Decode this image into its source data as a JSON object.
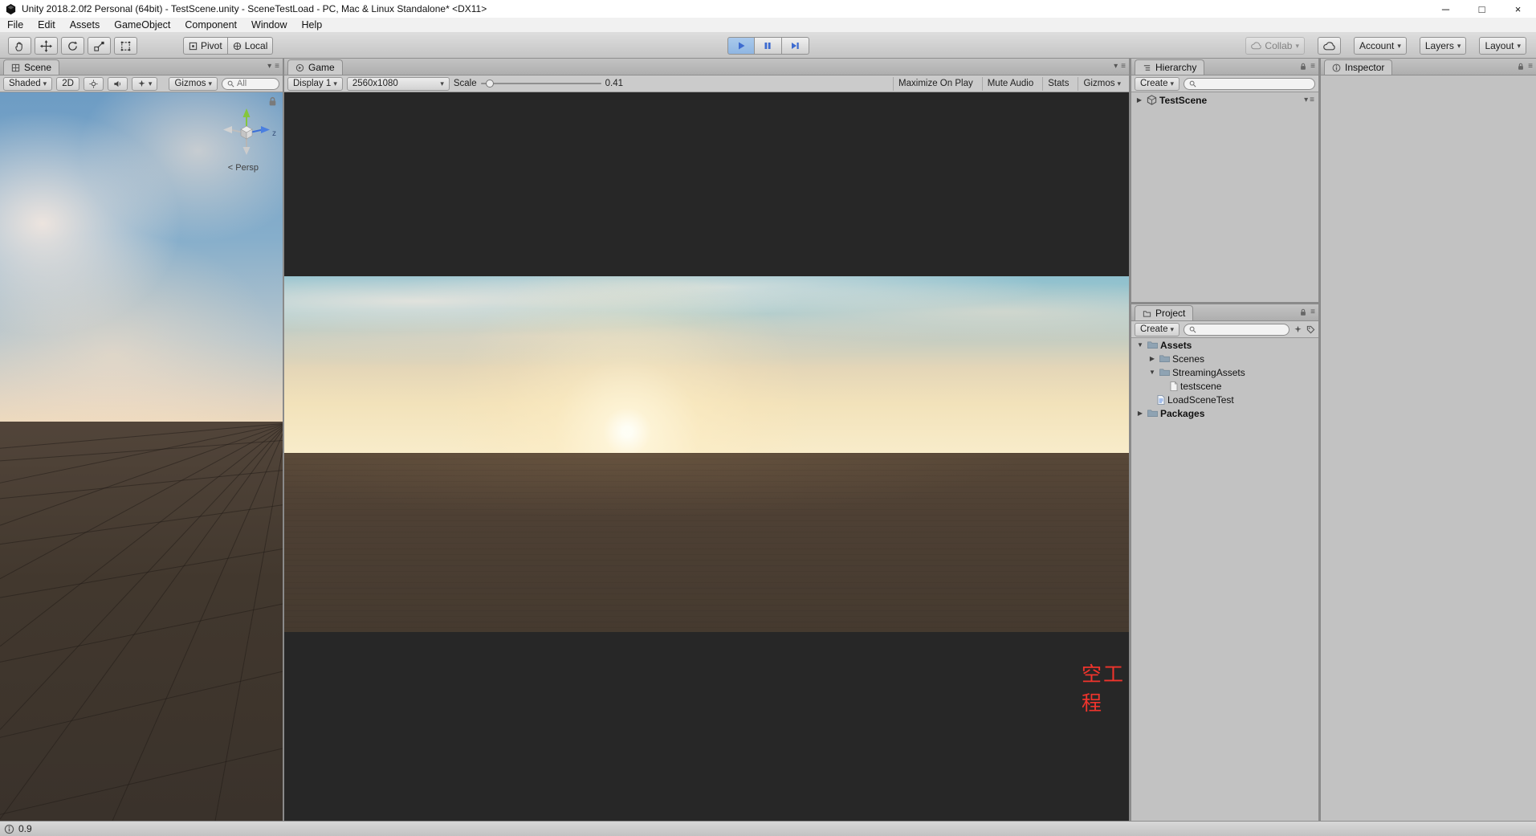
{
  "window": {
    "title": "Unity 2018.2.0f2 Personal (64bit) - TestScene.unity - SceneTestLoad - PC, Mac & Linux Standalone* <DX11>"
  },
  "icons": {
    "caret": "▾",
    "menu": "≡",
    "minimize": "─",
    "maximize": "□",
    "close": "×",
    "foldout_open": "▼",
    "foldout_closed": "▶"
  },
  "menu": {
    "items": [
      "File",
      "Edit",
      "Assets",
      "GameObject",
      "Component",
      "Window",
      "Help"
    ]
  },
  "toolbar": {
    "pivot_label": "Pivot",
    "local_label": "Local",
    "collab_label": "Collab",
    "account_label": "Account",
    "layers_label": "Layers",
    "layout_label": "Layout"
  },
  "scene": {
    "tab_label": "Scene",
    "shaded_label": "Shaded",
    "mode_2d_label": "2D",
    "gizmos_label": "Gizmos",
    "search_placeholder": "All",
    "persp_label": "< Persp",
    "axis_z_label": "z"
  },
  "game": {
    "tab_label": "Game",
    "display_label": "Display 1",
    "resolution_label": "2560x1080",
    "scale_label": "Scale",
    "scale_value": "0.41",
    "maximize_label": "Maximize On Play",
    "mute_label": "Mute Audio",
    "stats_label": "Stats",
    "gizmos_label": "Gizmos",
    "overlay_text": "空工程"
  },
  "hierarchy": {
    "tab_label": "Hierarchy",
    "create_label": "Create",
    "scene_item": "TestScene"
  },
  "project": {
    "tab_label": "Project",
    "create_label": "Create",
    "tree": [
      {
        "label": "Assets"
      },
      {
        "label": "Scenes"
      },
      {
        "label": "StreamingAssets"
      },
      {
        "label": "testscene"
      },
      {
        "label": "LoadSceneTest"
      },
      {
        "label": "Packages"
      }
    ]
  },
  "inspector": {
    "tab_label": "Inspector"
  },
  "status": {
    "message": "0.9"
  }
}
